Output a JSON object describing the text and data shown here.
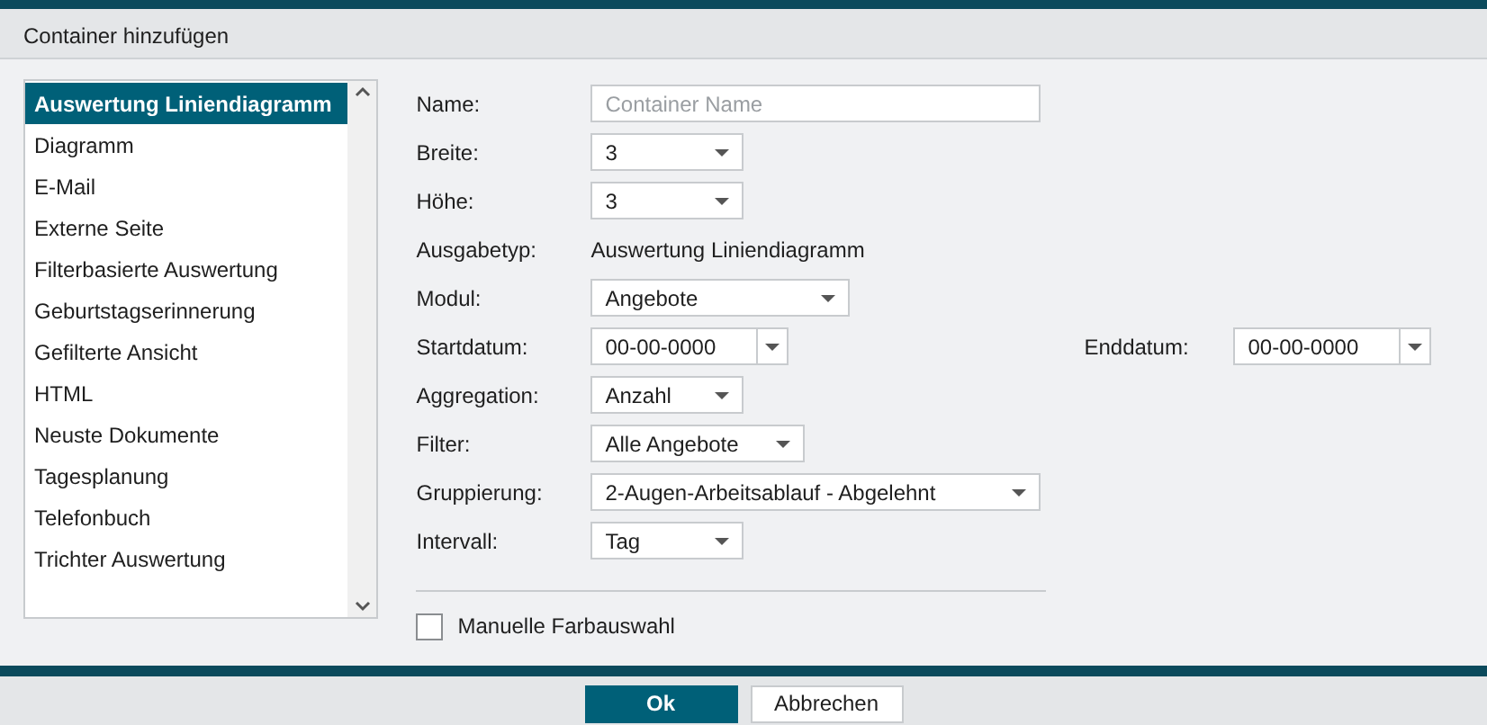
{
  "window": {
    "title": "Container hinzufügen"
  },
  "types": {
    "items": [
      {
        "label": "Auswertung Liniendiagramm",
        "selected": true
      },
      {
        "label": "Diagramm",
        "selected": false
      },
      {
        "label": "E-Mail",
        "selected": false
      },
      {
        "label": "Externe Seite",
        "selected": false
      },
      {
        "label": "Filterbasierte Auswertung",
        "selected": false
      },
      {
        "label": "Geburtstagserinnerung",
        "selected": false
      },
      {
        "label": "Gefilterte Ansicht",
        "selected": false
      },
      {
        "label": "HTML",
        "selected": false
      },
      {
        "label": "Neuste Dokumente",
        "selected": false
      },
      {
        "label": "Tagesplanung",
        "selected": false
      },
      {
        "label": "Telefonbuch",
        "selected": false
      },
      {
        "label": "Trichter Auswertung",
        "selected": false
      }
    ]
  },
  "form": {
    "rows": [
      {
        "label": "Name:",
        "kind": "text",
        "placeholder": "Container Name"
      },
      {
        "label": "Breite:",
        "kind": "select",
        "value": "3"
      },
      {
        "label": "Höhe:",
        "kind": "select",
        "value": "3"
      },
      {
        "label": "Ausgabetyp:",
        "kind": "static",
        "value": "Auswertung Liniendiagramm"
      },
      {
        "label": "Modul:",
        "kind": "select",
        "value": "Angebote"
      },
      {
        "label": "Startdatum:",
        "kind": "date",
        "value": "00-00-0000",
        "end": {
          "label": "Enddatum:",
          "value": "00-00-0000"
        }
      },
      {
        "label": "Aggregation:",
        "kind": "select",
        "value": "Anzahl"
      },
      {
        "label": "Filter:",
        "kind": "select",
        "value": "Alle Angebote"
      },
      {
        "label": "Gruppierung:",
        "kind": "select",
        "value": "2-Augen-Arbeitsablauf - Abgelehnt"
      },
      {
        "label": "Intervall:",
        "kind": "select",
        "value": "Tag"
      }
    ]
  },
  "checkbox": {
    "label": "Manuelle Farbauswahl",
    "checked": false
  },
  "buttons": [
    {
      "label": "Ok",
      "kind": "primary"
    },
    {
      "label": "Abbrechen",
      "kind": "secondary"
    }
  ]
}
